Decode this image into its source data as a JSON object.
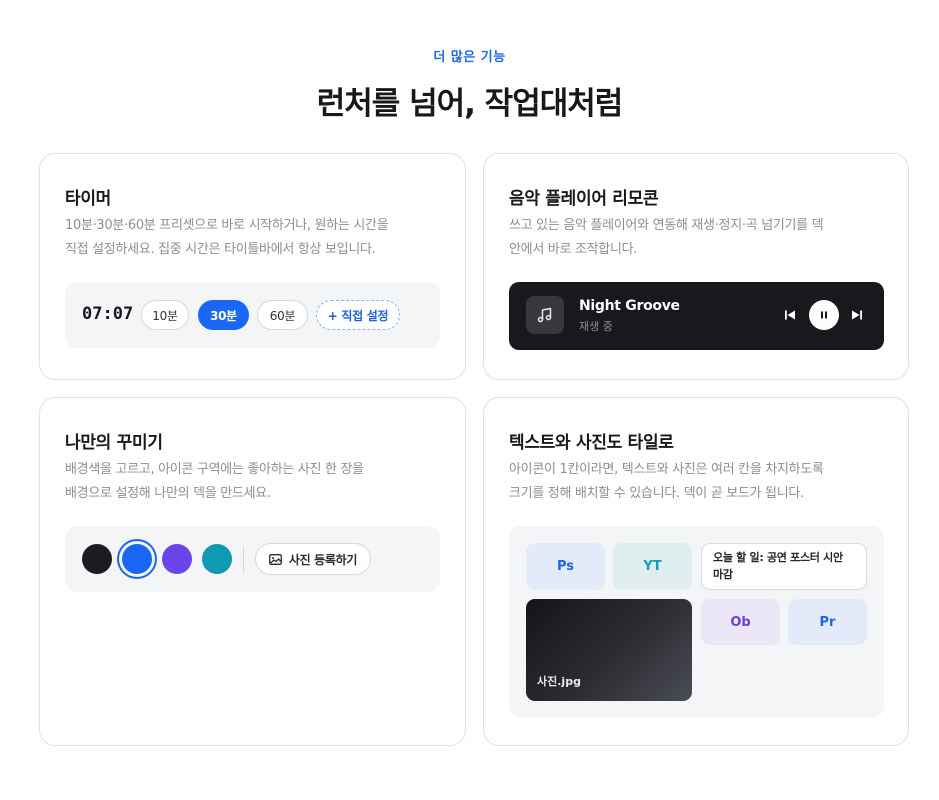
{
  "section": {
    "eyebrow": "더 많은 기능",
    "title": "런처를 넘어, 작업대처럼"
  },
  "timer_card": {
    "title": "타이머",
    "desc_line1": "10분·30분·60분 프리셋으로 바로 시작하거나, 원하는 시간을",
    "desc_line2": "직접 설정하세요. 집중 시간은 타이틀바에서 항상 보입니다.",
    "time": "07:07",
    "presets": [
      "10분",
      "30분",
      "60분"
    ],
    "active_preset": "30분",
    "custom_label": "+ 직접 설정"
  },
  "music_card": {
    "title": "음악 플레이어 리모콘",
    "desc_line1": "쓰고 있는 음악 플레이어와 연동해 재생·정지·곡 넘기기를 덱",
    "desc_line2": "안에서 바로 조작합니다.",
    "track": "Night Groove",
    "status": "재생 중",
    "icons": {
      "art": "music-note-icon",
      "prev": "skip-previous-icon",
      "play": "pause-icon",
      "next": "skip-next-icon"
    }
  },
  "decor_card": {
    "title": "나만의 꾸미기",
    "desc_line1": "배경색을 고르고, 아이콘 구역에는 좋아하는 사진 한 장을",
    "desc_line2": "배경으로 설정해 나만의 덱을 만드세요.",
    "swatches": [
      "#1b1c1f",
      "#1a66f5",
      "#6b45ea",
      "#0f99b2"
    ],
    "selected_swatch": "#1a66f5",
    "photo_button": "사진 등록하기"
  },
  "tiles_card": {
    "title": "텍스트와 사진도 타일로",
    "desc_line1": "아이콘이 1칸이라면, 텍스트와 사진은 여러 칸을 차지하도록",
    "desc_line2": "크기를 정해 배치할 수 있습니다. 덱이 곧 보드가 됩니다.",
    "tiles": {
      "ps": "Ps",
      "yt": "YT",
      "ob": "Ob",
      "pr": "Pr",
      "note": "오늘 할 일: 공연 포스터 시안 마감",
      "photo": "사진.jpg"
    },
    "colors": {
      "ps_bg": "#e3ebfa",
      "ps_fg": "#1f66e0",
      "yt_bg": "#e0eef0",
      "yt_fg": "#13a0b4",
      "ob_bg": "#ebe7f7",
      "ob_fg": "#6b3fd6",
      "pr_bg": "#e3ebfa",
      "pr_fg": "#1f66e0"
    }
  }
}
